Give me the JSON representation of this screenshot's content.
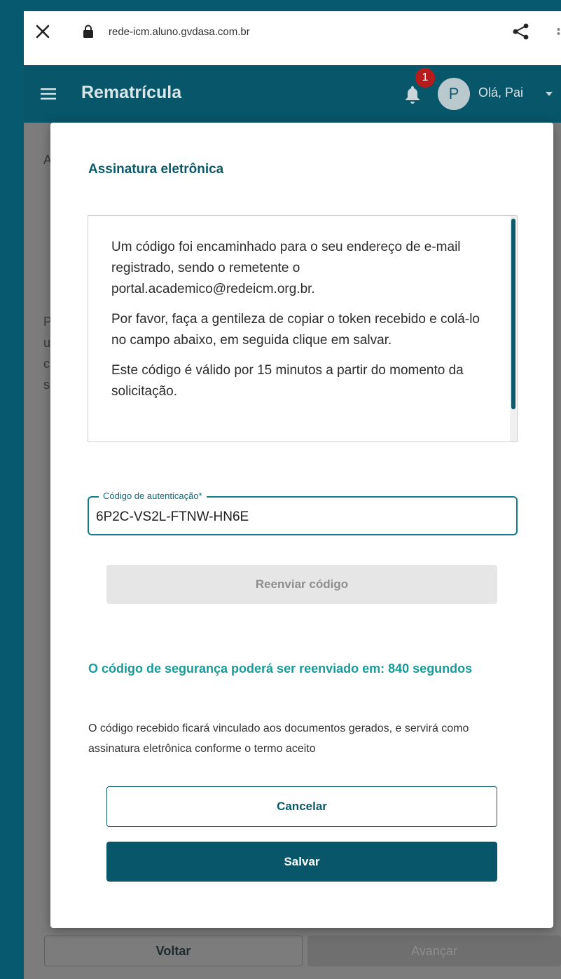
{
  "browser": {
    "url": "rede-icm.aluno.gvdasa.com.br",
    "close_icon": "close-icon",
    "lock_icon": "lock-icon",
    "share_icon": "share-icon"
  },
  "header": {
    "title": "Rematrícula",
    "notification_count": "1",
    "avatar_initial": "P",
    "greeting": "Olá, Pai"
  },
  "background_page": {
    "ghost_letters": [
      "A",
      "P",
      "u",
      "c",
      "s"
    ],
    "back_label": "Voltar",
    "next_label": "Avançar"
  },
  "modal": {
    "title": "Assinatura eletrônica",
    "paragraphs": [
      "Um código foi encaminhado para o seu endereço de e-mail registrado, sendo o remetente o portal.academico@redeicm.org.br.",
      "Por favor, faça a gentileza de copiar o token recebido e colá-lo no campo abaixo, em seguida clique em salvar.",
      "Este código é válido por 15 minutos a partir do momento da solicitação."
    ],
    "field_label": "Código de autenticação*",
    "field_value": "6P2C-VS2L-FTNW-HN6E",
    "resend_label": "Reenviar código",
    "countdown_text": "O código de segurança poderá ser reenviado em: 840 segundos",
    "note": "O código recebido ficará vinculado aos documentos gerados, e servirá como assinatura eletrônica conforme o termo aceito",
    "cancel_label": "Cancelar",
    "save_label": "Salvar"
  },
  "colors": {
    "primary": "#075669",
    "accent": "#1b9a9a",
    "badge": "#b71c1c",
    "outer_background": "#06596e"
  }
}
